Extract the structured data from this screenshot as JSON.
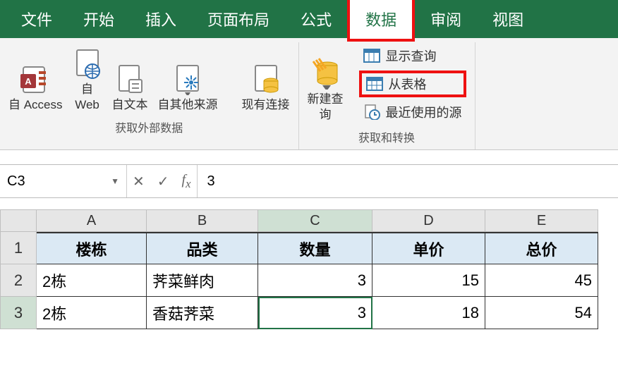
{
  "menu": {
    "file": "文件",
    "home": "开始",
    "insert": "插入",
    "layout": "页面布局",
    "formula": "公式",
    "data": "数据",
    "review": "审阅",
    "view": "视图"
  },
  "ribbon": {
    "group1": {
      "access": "自 Access",
      "web": "自\nWeb",
      "text": "自文本",
      "other": "自其他来源",
      "existing": "现有连接",
      "label": "获取外部数据"
    },
    "group2": {
      "newquery": "新建查\n询",
      "showquery": "显示查询",
      "fromtable": "从表格",
      "recent": "最近使用的源",
      "label": "获取和转换"
    }
  },
  "formula_bar": {
    "cellref": "C3",
    "value": "3"
  },
  "sheet": {
    "cols": [
      "A",
      "B",
      "C",
      "D",
      "E"
    ],
    "headers": {
      "A": "楼栋",
      "B": "品类",
      "C": "数量",
      "D": "单价",
      "E": "总价"
    },
    "rows": [
      {
        "n": "2",
        "A": "2栋",
        "B": "荠菜鲜肉",
        "C": "3",
        "D": "15",
        "E": "45"
      },
      {
        "n": "3",
        "A": "2栋",
        "B": "香菇荠菜",
        "C": "3",
        "D": "18",
        "E": "54"
      }
    ],
    "active_cell": "C3"
  },
  "chart_data": {
    "type": "table",
    "columns": [
      "楼栋",
      "品类",
      "数量",
      "单价",
      "总价"
    ],
    "rows": [
      [
        "2栋",
        "荠菜鲜肉",
        3,
        15,
        45
      ],
      [
        "2栋",
        "香菇荠菜",
        3,
        18,
        54
      ]
    ]
  }
}
